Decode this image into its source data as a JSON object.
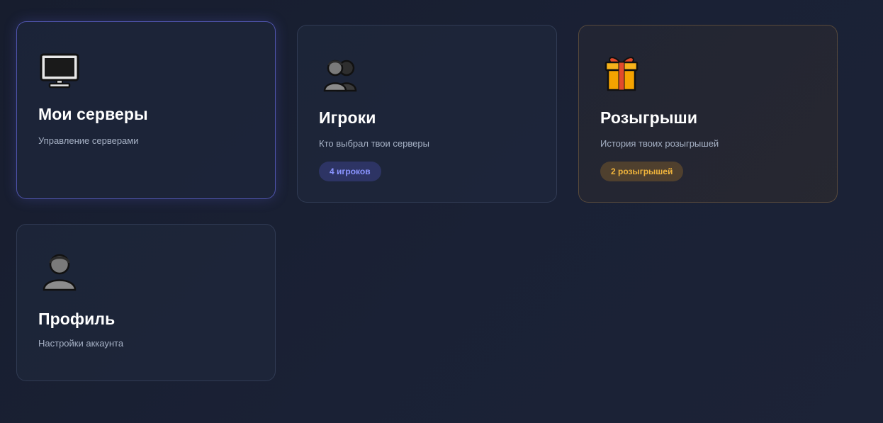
{
  "cards": [
    {
      "icon": "monitor-icon",
      "title": "Мои серверы",
      "subtitle": "Управление серверами"
    },
    {
      "icon": "players-icon",
      "title": "Игроки",
      "subtitle": "Кто выбрал твои серверы",
      "badge": "4 игроков"
    },
    {
      "icon": "gift-icon",
      "title": "Розыгрыши",
      "subtitle": "История твоих розыгрышей",
      "badge": "2 розыгрышей"
    },
    {
      "icon": "user-icon",
      "title": "Профиль",
      "subtitle": "Настройки аккаунта"
    }
  ],
  "colors": {
    "accent_blue": "#6266d6",
    "badge_blue_text": "#8a94ff",
    "badge_amber_text": "#f0b43c",
    "background": "#1a2135"
  }
}
